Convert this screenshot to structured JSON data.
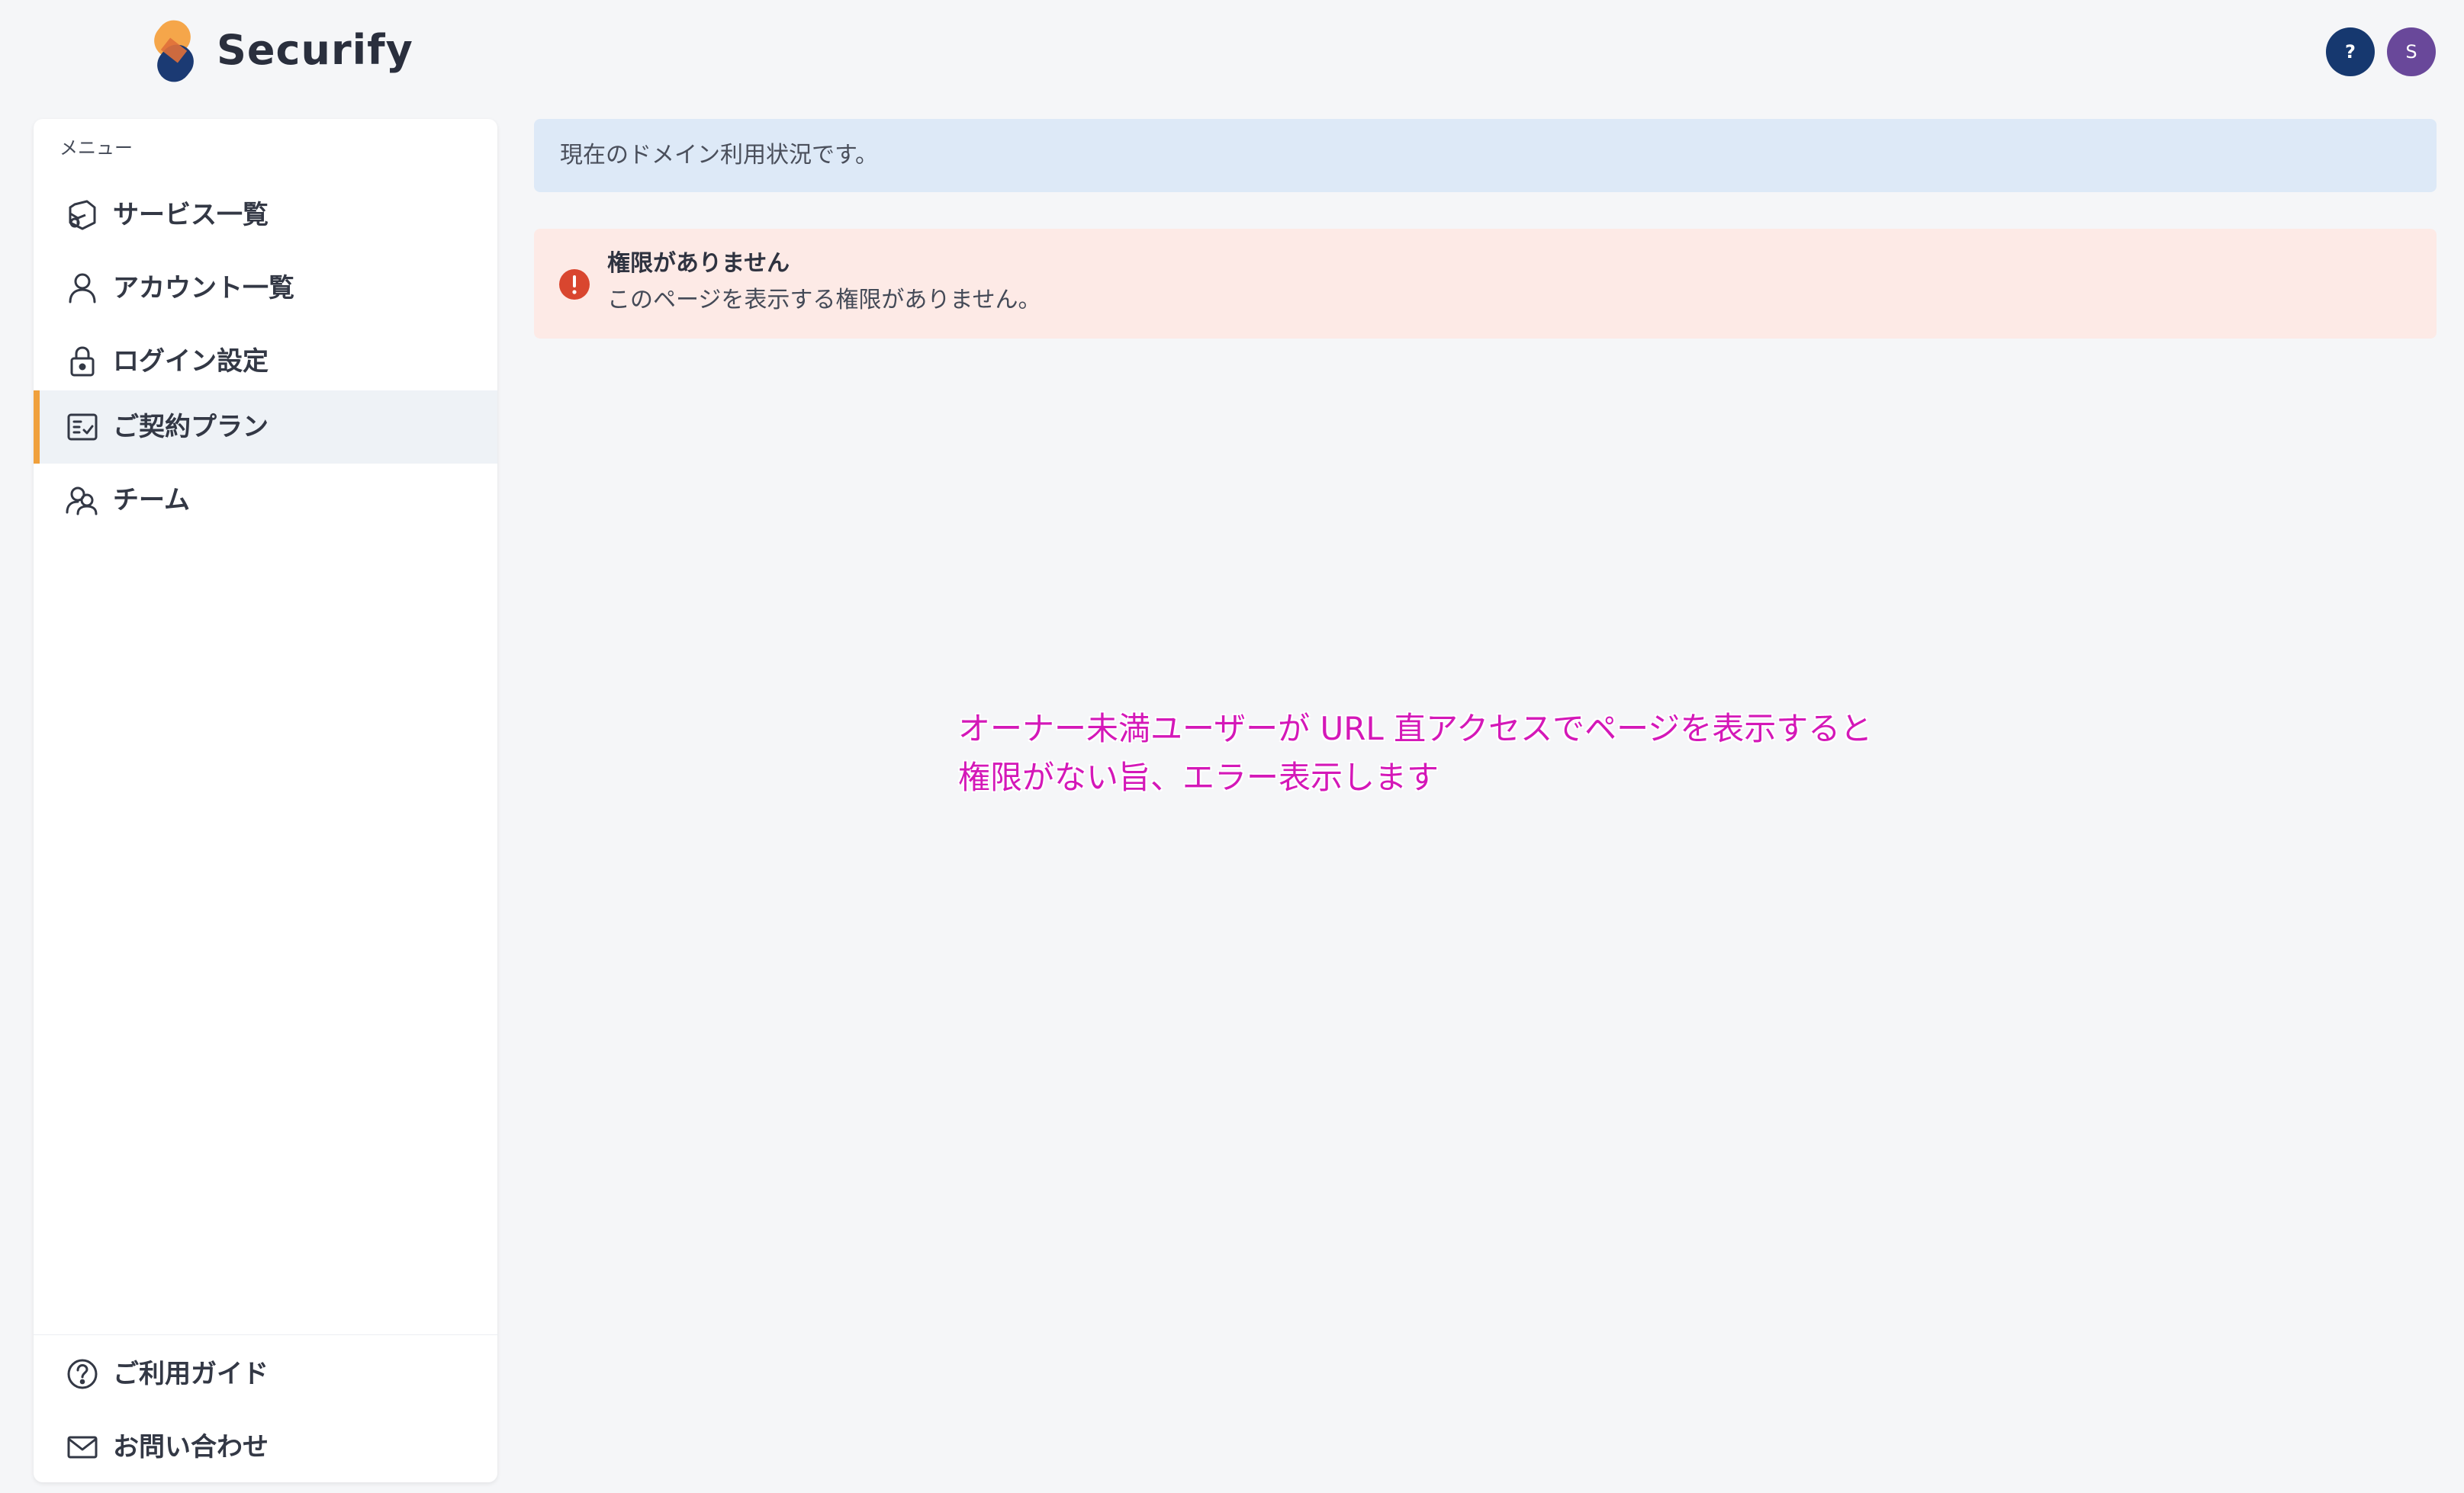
{
  "header": {
    "brand": "Securify",
    "help_label": "?",
    "avatar_label": "S"
  },
  "sidebar": {
    "caption": "メニュー",
    "items": [
      {
        "label": "サービス一覧",
        "icon": "cube-icon"
      },
      {
        "label": "アカウント一覧",
        "icon": "user-icon"
      },
      {
        "label": "ログイン設定",
        "icon": "lock-icon"
      },
      {
        "label": "ご契約プラン",
        "icon": "contract-icon",
        "active": true
      },
      {
        "label": "チーム",
        "icon": "team-icon"
      }
    ],
    "bottom_items": [
      {
        "label": "ご利用ガイド",
        "icon": "help-circle-icon"
      },
      {
        "label": "お問い合わせ",
        "icon": "mail-icon"
      }
    ]
  },
  "main": {
    "info_text": "現在のドメイン利用状況です。",
    "error": {
      "title": "権限がありません",
      "message": "このページを表示する権限がありません。"
    },
    "annotation": {
      "line1": "オーナー未満ユーザーが URL 直アクセスでページを表示すると",
      "line2": "権限がない旨、エラー表示します"
    }
  },
  "colors": {
    "accent": "#f0a03c",
    "info_bg": "#dde9f7",
    "error_bg": "#fdeae6",
    "error_icon": "#d9462f",
    "annotation": "#d418b8",
    "help_button": "#16386f",
    "avatar": "#69489a"
  }
}
